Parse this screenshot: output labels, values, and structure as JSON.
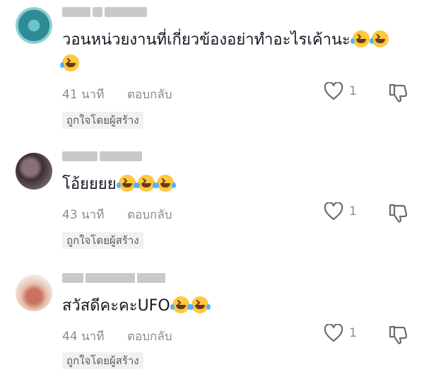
{
  "comments": [
    {
      "text": "วอนหน่วยงานที่เกี่ยวข้องอย่าทำอะไรเค้านะ",
      "emojis": [
        "rolling-laughing-emoji",
        "rolling-laughing-emoji",
        "rolling-laughing-emoji"
      ],
      "time": "41 นาที",
      "reply_label": "ตอบกลับ",
      "likes": "1",
      "creator_badge": "ถูกใจโดยผู้สร้าง",
      "avatar_color": "#2e8c96"
    },
    {
      "text": "โอ้ยยยย",
      "emojis": [
        "tears-of-joy-emoji",
        "tears-of-joy-emoji",
        "tears-of-joy-emoji"
      ],
      "time": "43 นาที",
      "reply_label": "ตอบกลับ",
      "likes": "1",
      "creator_badge": "ถูกใจโดยผู้สร้าง",
      "avatar_color": "#5a4e54"
    },
    {
      "text": "สวัสดีคะคะUFO",
      "emojis": [
        "tears-of-joy-emoji",
        "tears-of-joy-emoji"
      ],
      "time": "44 นาที",
      "reply_label": "ตอบกลับ",
      "likes": "1",
      "creator_badge": "ถูกใจโดยผู้สร้าง",
      "avatar_color": "#d9a38c"
    }
  ],
  "colors": {
    "text": "#161823",
    "secondary": "#8a8b91",
    "chip_bg": "#f1f1f2",
    "emoji": "#ffc83d"
  }
}
